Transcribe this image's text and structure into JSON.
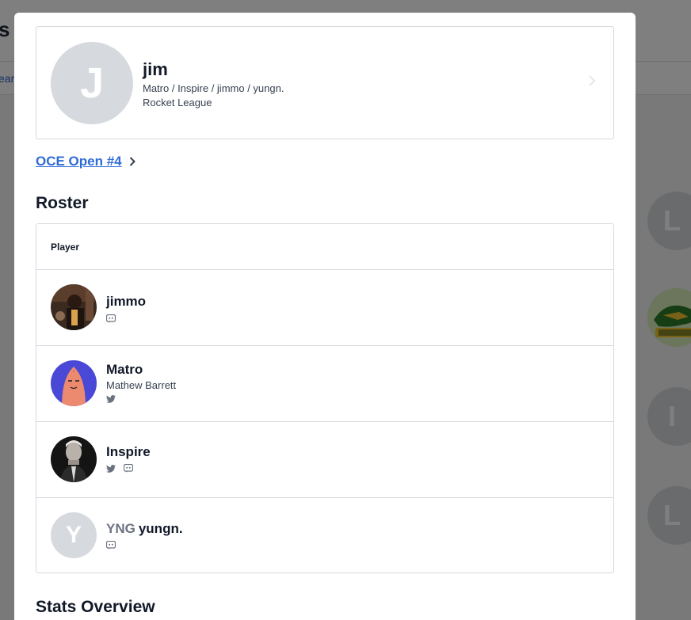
{
  "background": {
    "title_fragment": "s",
    "tab_fragment": "ear",
    "avatars": [
      "L",
      "I",
      "L"
    ]
  },
  "team": {
    "initial": "J",
    "name": "jim",
    "players_line": "Matro / Inspire / jimmo / yungn.",
    "game": "Rocket League"
  },
  "event": {
    "label": "OCE Open #4"
  },
  "roster": {
    "title": "Roster",
    "column_header": "Player",
    "players": [
      {
        "name": "jimmo",
        "tag": "",
        "real_name": "",
        "socials": [
          "discord-icon"
        ]
      },
      {
        "name": "Matro",
        "tag": "",
        "real_name": "Mathew Barrett",
        "socials": [
          "twitter-icon"
        ]
      },
      {
        "name": "Inspire",
        "tag": "",
        "real_name": "",
        "socials": [
          "twitter-icon",
          "discord-icon"
        ]
      },
      {
        "name": "yungn.",
        "tag": "YNG",
        "real_name": "",
        "initial": "Y",
        "socials": [
          "discord-icon"
        ]
      }
    ]
  },
  "stats": {
    "title": "Stats Overview"
  },
  "colors": {
    "link": "#2f6bd8",
    "border": "#d6d9de",
    "placeholder_avatar": "#d6d9de"
  }
}
